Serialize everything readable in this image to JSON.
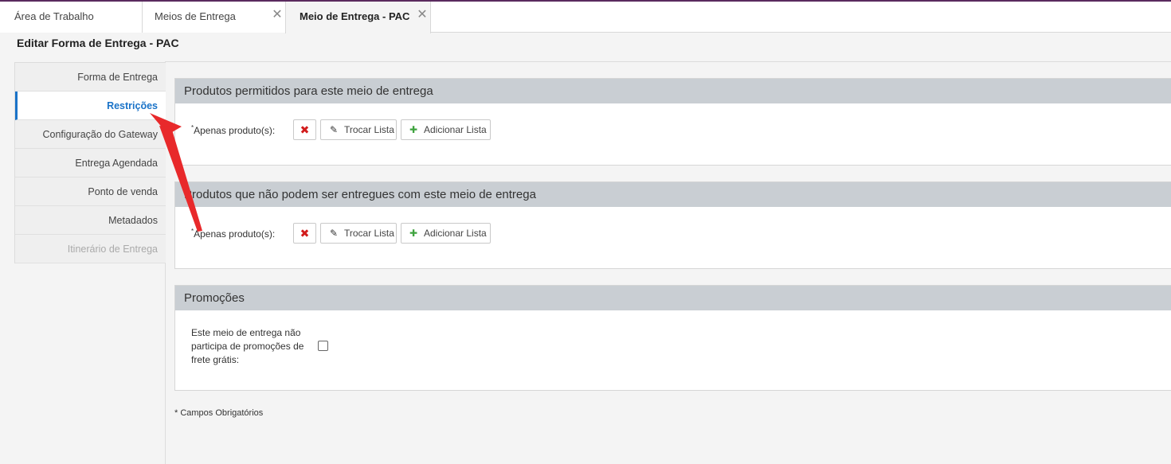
{
  "tabs": [
    {
      "label": "Área de Trabalho",
      "closable": false,
      "active": false
    },
    {
      "label": "Meios de Entrega",
      "closable": true,
      "active": false
    },
    {
      "label": "Meio de Entrega - PAC",
      "closable": true,
      "active": true
    }
  ],
  "page_title": "Editar Forma de Entrega - PAC",
  "sidebar": {
    "items": [
      {
        "label": "Forma de Entrega",
        "state": "normal"
      },
      {
        "label": "Restrições",
        "state": "active"
      },
      {
        "label": "Configuração do Gateway",
        "state": "normal"
      },
      {
        "label": "Entrega Agendada",
        "state": "normal"
      },
      {
        "label": "Ponto de venda",
        "state": "normal"
      },
      {
        "label": "Metadados",
        "state": "normal"
      },
      {
        "label": "Itinerário de Entrega",
        "state": "disabled"
      }
    ]
  },
  "panels": {
    "allowed": {
      "title": "Produtos permitidos para este meio de entrega",
      "required_mark": "*",
      "field_label": "Apenas produto(s):",
      "remove_icon": "close-icon",
      "swap_label": "Trocar Lista",
      "add_label": "Adicionar Lista"
    },
    "blocked": {
      "title": "Produtos que não podem ser entregues com este meio de entrega",
      "required_mark": "*",
      "field_label": "Apenas produto(s):",
      "remove_icon": "close-icon",
      "swap_label": "Trocar Lista",
      "add_label": "Adicionar Lista"
    },
    "promotions": {
      "title": "Promoções",
      "checkbox_label": "Este meio de entrega não participa de promoções de frete grátis:",
      "checked": false
    }
  },
  "footnote": "* Campos Obrigatórios",
  "colors": {
    "accent": "#1a73c8",
    "panel_header": "#c9ced3",
    "remove": "#d21c1c",
    "add": "#3fa33f",
    "annotation_arrow": "#e8292b",
    "top_line": "#5a2a5e"
  }
}
